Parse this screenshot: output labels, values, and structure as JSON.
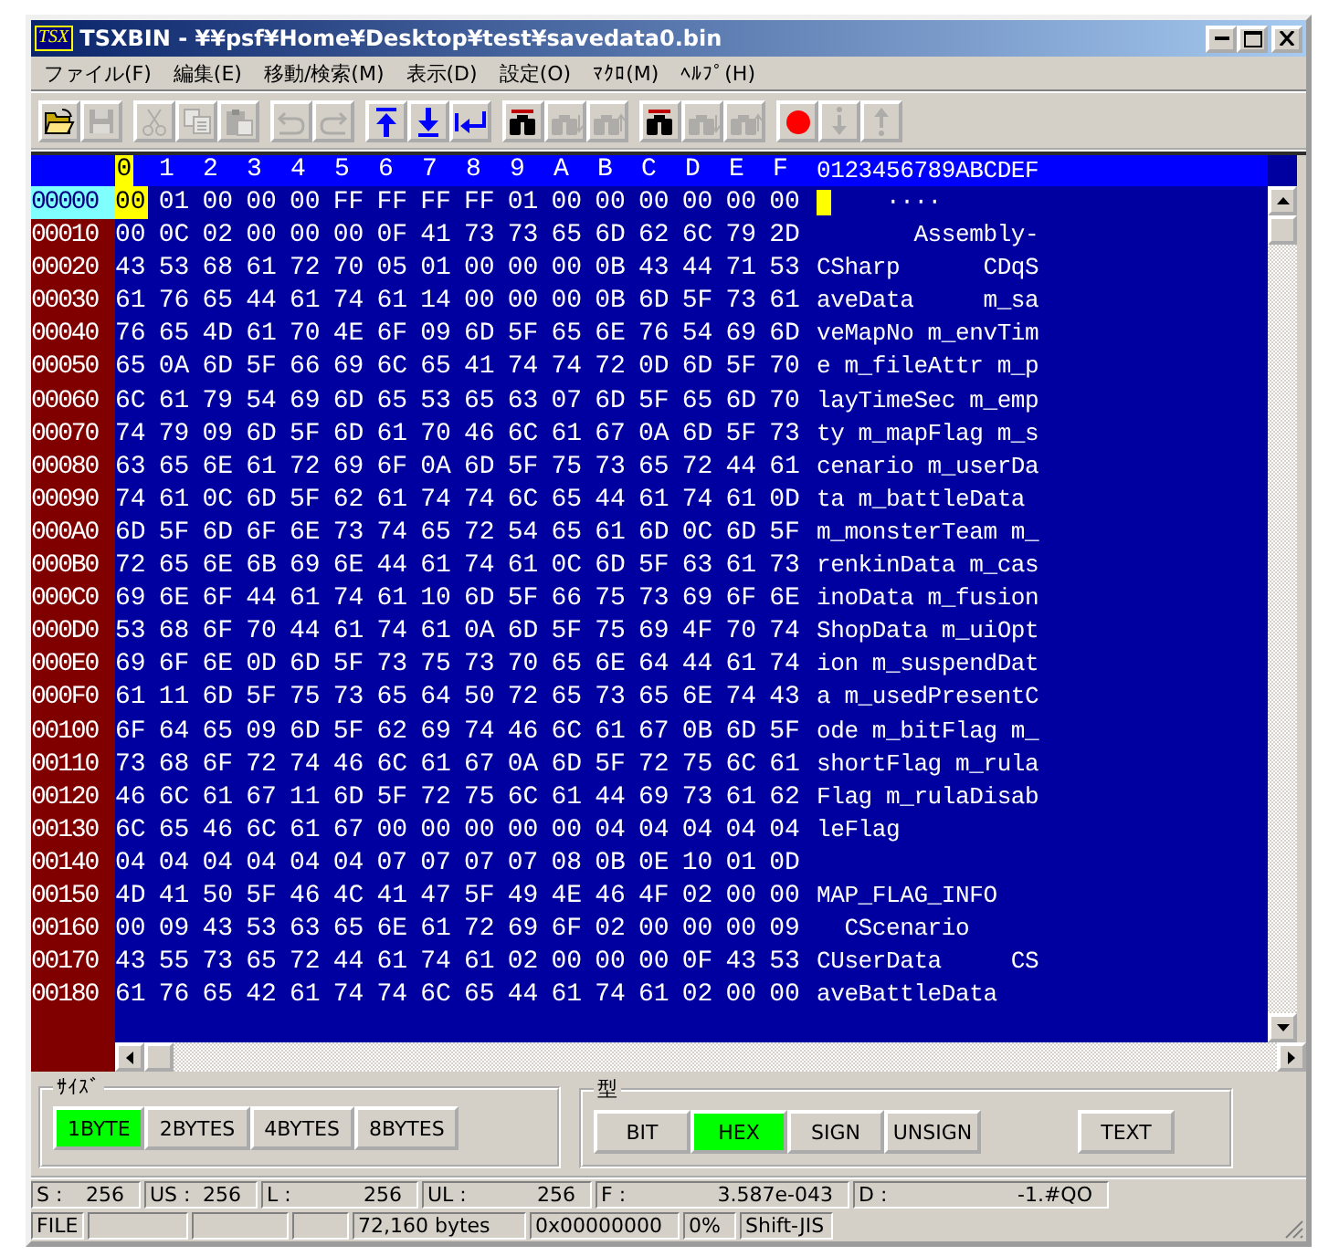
{
  "window": {
    "app_icon_text": "TSX",
    "title": "TSXBIN - ¥¥psf¥Home¥Desktop¥test¥savedata0.bin"
  },
  "menu": [
    "ファイル(F)",
    "編集(E)",
    "移動/検索(M)",
    "表示(D)",
    "設定(O)",
    "ﾏｸﾛ(M)",
    "ﾍﾙﾌﾟ(H)"
  ],
  "toolbar": [
    [
      {
        "kind": "open",
        "disabled": false
      },
      {
        "kind": "save",
        "disabled": true
      }
    ],
    [
      {
        "kind": "cut",
        "disabled": true
      },
      {
        "kind": "copy",
        "disabled": true
      },
      {
        "kind": "paste",
        "disabled": true
      }
    ],
    [
      {
        "kind": "undo",
        "disabled": true
      },
      {
        "kind": "redo",
        "disabled": true
      }
    ],
    [
      {
        "kind": "top",
        "disabled": false
      },
      {
        "kind": "bottom",
        "disabled": false
      },
      {
        "kind": "jump",
        "disabled": false
      }
    ],
    [
      {
        "kind": "find",
        "disabled": false
      },
      {
        "kind": "find-down",
        "disabled": true
      },
      {
        "kind": "find-up",
        "disabled": true
      }
    ],
    [
      {
        "kind": "find",
        "disabled": false
      },
      {
        "kind": "find-down",
        "disabled": true
      },
      {
        "kind": "find-up",
        "disabled": true
      }
    ],
    [
      {
        "kind": "record",
        "disabled": false
      },
      {
        "kind": "step-down",
        "disabled": true
      },
      {
        "kind": "step-up",
        "disabled": true
      }
    ]
  ],
  "hex": {
    "columns": [
      {
        "label": "0",
        "selected": true
      },
      {
        "label": "1",
        "selected": false
      },
      {
        "label": "2",
        "selected": false
      },
      {
        "label": "3",
        "selected": false
      },
      {
        "label": "4",
        "selected": false
      },
      {
        "label": "5",
        "selected": false
      },
      {
        "label": "6",
        "selected": false
      },
      {
        "label": "7",
        "selected": false
      },
      {
        "label": "8",
        "selected": false
      },
      {
        "label": "9",
        "selected": false
      },
      {
        "label": "A",
        "selected": false
      },
      {
        "label": "B",
        "selected": false
      },
      {
        "label": "C",
        "selected": false
      },
      {
        "label": "D",
        "selected": false
      },
      {
        "label": "E",
        "selected": false
      },
      {
        "label": "F",
        "selected": false
      }
    ],
    "text_header": "0123456789ABCDEF",
    "rows": [
      {
        "address": "00000",
        "selected": true,
        "bytes": [
          "00",
          "01",
          "00",
          "00",
          "00",
          "FF",
          "FF",
          "FF",
          "FF",
          "01",
          "00",
          "00",
          "00",
          "00",
          "00",
          "00"
        ],
        "text": "     ····"
      },
      {
        "address": "00010",
        "selected": false,
        "bytes": [
          "00",
          "0C",
          "02",
          "00",
          "00",
          "00",
          "0F",
          "41",
          "73",
          "73",
          "65",
          "6D",
          "62",
          "6C",
          "79",
          "2D"
        ],
        "text": "       Assembly-"
      },
      {
        "address": "00020",
        "selected": false,
        "bytes": [
          "43",
          "53",
          "68",
          "61",
          "72",
          "70",
          "05",
          "01",
          "00",
          "00",
          "00",
          "0B",
          "43",
          "44",
          "71",
          "53"
        ],
        "text": "CSharp      CDqS"
      },
      {
        "address": "00030",
        "selected": false,
        "bytes": [
          "61",
          "76",
          "65",
          "44",
          "61",
          "74",
          "61",
          "14",
          "00",
          "00",
          "00",
          "0B",
          "6D",
          "5F",
          "73",
          "61"
        ],
        "text": "aveData     m_sa"
      },
      {
        "address": "00040",
        "selected": false,
        "bytes": [
          "76",
          "65",
          "4D",
          "61",
          "70",
          "4E",
          "6F",
          "09",
          "6D",
          "5F",
          "65",
          "6E",
          "76",
          "54",
          "69",
          "6D"
        ],
        "text": "veMapNo m_envTim"
      },
      {
        "address": "00050",
        "selected": false,
        "bytes": [
          "65",
          "0A",
          "6D",
          "5F",
          "66",
          "69",
          "6C",
          "65",
          "41",
          "74",
          "74",
          "72",
          "0D",
          "6D",
          "5F",
          "70"
        ],
        "text": "e m_fileAttr m_p"
      },
      {
        "address": "00060",
        "selected": false,
        "bytes": [
          "6C",
          "61",
          "79",
          "54",
          "69",
          "6D",
          "65",
          "53",
          "65",
          "63",
          "07",
          "6D",
          "5F",
          "65",
          "6D",
          "70"
        ],
        "text": "layTimeSec m_emp"
      },
      {
        "address": "00070",
        "selected": false,
        "bytes": [
          "74",
          "79",
          "09",
          "6D",
          "5F",
          "6D",
          "61",
          "70",
          "46",
          "6C",
          "61",
          "67",
          "0A",
          "6D",
          "5F",
          "73"
        ],
        "text": "ty m_mapFlag m_s"
      },
      {
        "address": "00080",
        "selected": false,
        "bytes": [
          "63",
          "65",
          "6E",
          "61",
          "72",
          "69",
          "6F",
          "0A",
          "6D",
          "5F",
          "75",
          "73",
          "65",
          "72",
          "44",
          "61"
        ],
        "text": "cenario m_userDa"
      },
      {
        "address": "00090",
        "selected": false,
        "bytes": [
          "74",
          "61",
          "0C",
          "6D",
          "5F",
          "62",
          "61",
          "74",
          "74",
          "6C",
          "65",
          "44",
          "61",
          "74",
          "61",
          "0D"
        ],
        "text": "ta m_battleData"
      },
      {
        "address": "000A0",
        "selected": false,
        "bytes": [
          "6D",
          "5F",
          "6D",
          "6F",
          "6E",
          "73",
          "74",
          "65",
          "72",
          "54",
          "65",
          "61",
          "6D",
          "0C",
          "6D",
          "5F"
        ],
        "text": "m_monsterTeam m_"
      },
      {
        "address": "000B0",
        "selected": false,
        "bytes": [
          "72",
          "65",
          "6E",
          "6B",
          "69",
          "6E",
          "44",
          "61",
          "74",
          "61",
          "0C",
          "6D",
          "5F",
          "63",
          "61",
          "73"
        ],
        "text": "renkinData m_cas"
      },
      {
        "address": "000C0",
        "selected": false,
        "bytes": [
          "69",
          "6E",
          "6F",
          "44",
          "61",
          "74",
          "61",
          "10",
          "6D",
          "5F",
          "66",
          "75",
          "73",
          "69",
          "6F",
          "6E"
        ],
        "text": "inoData m_fusion"
      },
      {
        "address": "000D0",
        "selected": false,
        "bytes": [
          "53",
          "68",
          "6F",
          "70",
          "44",
          "61",
          "74",
          "61",
          "0A",
          "6D",
          "5F",
          "75",
          "69",
          "4F",
          "70",
          "74"
        ],
        "text": "ShopData m_uiOpt"
      },
      {
        "address": "000E0",
        "selected": false,
        "bytes": [
          "69",
          "6F",
          "6E",
          "0D",
          "6D",
          "5F",
          "73",
          "75",
          "73",
          "70",
          "65",
          "6E",
          "64",
          "44",
          "61",
          "74"
        ],
        "text": "ion m_suspendDat"
      },
      {
        "address": "000F0",
        "selected": false,
        "bytes": [
          "61",
          "11",
          "6D",
          "5F",
          "75",
          "73",
          "65",
          "64",
          "50",
          "72",
          "65",
          "73",
          "65",
          "6E",
          "74",
          "43"
        ],
        "text": "a m_usedPresentC"
      },
      {
        "address": "00100",
        "selected": false,
        "bytes": [
          "6F",
          "64",
          "65",
          "09",
          "6D",
          "5F",
          "62",
          "69",
          "74",
          "46",
          "6C",
          "61",
          "67",
          "0B",
          "6D",
          "5F"
        ],
        "text": "ode m_bitFlag m_"
      },
      {
        "address": "00110",
        "selected": false,
        "bytes": [
          "73",
          "68",
          "6F",
          "72",
          "74",
          "46",
          "6C",
          "61",
          "67",
          "0A",
          "6D",
          "5F",
          "72",
          "75",
          "6C",
          "61"
        ],
        "text": "shortFlag m_rula"
      },
      {
        "address": "00120",
        "selected": false,
        "bytes": [
          "46",
          "6C",
          "61",
          "67",
          "11",
          "6D",
          "5F",
          "72",
          "75",
          "6C",
          "61",
          "44",
          "69",
          "73",
          "61",
          "62"
        ],
        "text": "Flag m_rulaDisab"
      },
      {
        "address": "00130",
        "selected": false,
        "bytes": [
          "6C",
          "65",
          "46",
          "6C",
          "61",
          "67",
          "00",
          "00",
          "00",
          "00",
          "00",
          "04",
          "04",
          "04",
          "04",
          "04"
        ],
        "text": "leFlag"
      },
      {
        "address": "00140",
        "selected": false,
        "bytes": [
          "04",
          "04",
          "04",
          "04",
          "04",
          "04",
          "07",
          "07",
          "07",
          "07",
          "08",
          "0B",
          "0E",
          "10",
          "01",
          "0D"
        ]
      },
      {
        "address": "00150",
        "selected": false,
        "bytes": [
          "4D",
          "41",
          "50",
          "5F",
          "46",
          "4C",
          "41",
          "47",
          "5F",
          "49",
          "4E",
          "46",
          "4F",
          "02",
          "00",
          "00"
        ],
        "text": "MAP_FLAG_INFO"
      },
      {
        "address": "00160",
        "selected": false,
        "bytes": [
          "00",
          "09",
          "43",
          "53",
          "63",
          "65",
          "6E",
          "61",
          "72",
          "69",
          "6F",
          "02",
          "00",
          "00",
          "00",
          "09"
        ],
        "text": "  CScenario"
      },
      {
        "address": "00170",
        "selected": false,
        "bytes": [
          "43",
          "55",
          "73",
          "65",
          "72",
          "44",
          "61",
          "74",
          "61",
          "02",
          "00",
          "00",
          "00",
          "0F",
          "43",
          "53"
        ],
        "text": "CUserData     CS"
      },
      {
        "address": "00180",
        "selected": false,
        "bytes": [
          "61",
          "76",
          "65",
          "42",
          "61",
          "74",
          "74",
          "6C",
          "65",
          "44",
          "61",
          "74",
          "61",
          "02",
          "00",
          "00"
        ],
        "text": "aveBattleData"
      }
    ]
  },
  "size_group": {
    "label": "ｻｲｽﾞ",
    "buttons": [
      {
        "label": "1BYTE",
        "selected": true
      },
      {
        "label": "2BYTES",
        "selected": false
      },
      {
        "label": "4BYTES",
        "selected": false
      },
      {
        "label": "8BYTES",
        "selected": false
      }
    ]
  },
  "type_group": {
    "label": "型",
    "buttons": [
      {
        "label": "BIT",
        "selected": false
      },
      {
        "label": "HEX",
        "selected": true
      },
      {
        "label": "SIGN",
        "selected": false
      },
      {
        "label": "UNSIGN",
        "selected": false
      }
    ],
    "text_button": "TEXT"
  },
  "values": [
    {
      "label": "S :",
      "value": "256"
    },
    {
      "label": "US :",
      "value": "256"
    },
    {
      "label": "L :",
      "value": "256"
    },
    {
      "label": "UL :",
      "value": "256"
    },
    {
      "label": "F :",
      "value": "3.587e-043"
    },
    {
      "label": "D :",
      "value": "-1.#QO"
    }
  ],
  "status": {
    "mode": "FILE",
    "size": "72,160 bytes",
    "offset": "0x00000000",
    "percent": "0%",
    "encoding": "Shift-JIS"
  }
}
